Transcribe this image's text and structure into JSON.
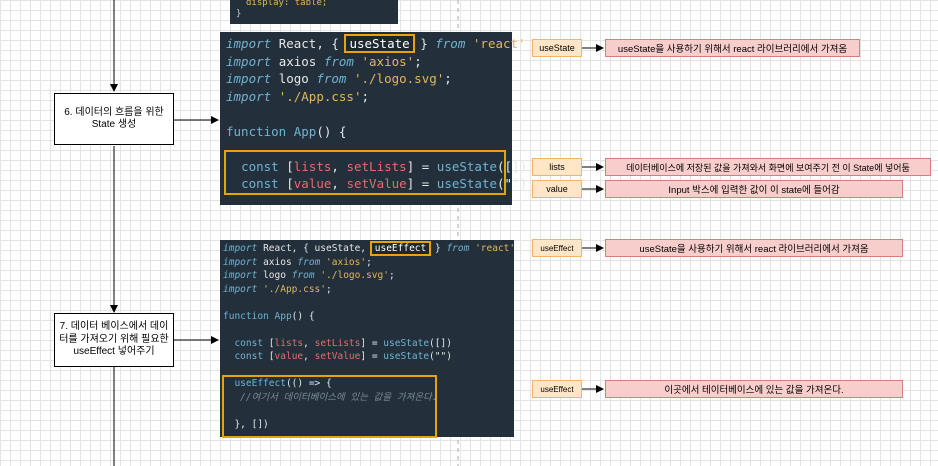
{
  "top_fragment": {
    "line": "display: table;",
    "brace": "}"
  },
  "step6": {
    "label": "6. 데이터의 흐름을 위한 State 생성"
  },
  "step7": {
    "label": "7. 데이터 베이스에서 데이터를 가져오기 위해 필요한 useEffect 넣어주기"
  },
  "code1": {
    "l1_import": "import",
    "l1_react": "React, {",
    "l1_usestate": "useState",
    "l1_close": "}",
    "l1_from": "from",
    "l1_str": "'react'",
    "l2_import": "import",
    "l2_name": "axios",
    "l2_from": "from",
    "l2_str": "'axios'",
    "l2_semi": ";",
    "l3_import": "import",
    "l3_name": "logo",
    "l3_from": "from",
    "l3_str": "'./logo.svg'",
    "l3_semi": ";",
    "l4_import": "import",
    "l4_str": "'./App.css'",
    "l4_semi": ";",
    "l5_function": "function",
    "l5_app": "App",
    "l5_rest": "() {",
    "l6_const": "const",
    "l6_open": "[",
    "l6_lists": "lists",
    "l6_comma": ",",
    "l6_setlists": "setLists",
    "l6_eq": "] =",
    "l6_call": "useState",
    "l6_args": "([])",
    "l7_const": "const",
    "l7_open": "[",
    "l7_value": "value",
    "l7_comma": ",",
    "l7_setvalue": "setValue",
    "l7_eq": "] =",
    "l7_call": "useState",
    "l7_args": "(\"\")"
  },
  "code2": {
    "l1_import": "import",
    "l1_react": "React, { useState,",
    "l1_useeffect": "useEffect",
    "l1_close": "}",
    "l1_from": "from",
    "l1_str": "'react'",
    "l2_import": "import",
    "l2_name": "axios",
    "l2_from": "from",
    "l2_str": "'axios'",
    "l2_semi": ";",
    "l3_import": "import",
    "l3_name": "logo",
    "l3_from": "from",
    "l3_str": "'./logo.svg'",
    "l3_semi": ";",
    "l4_import": "import",
    "l4_str": "'./App.css'",
    "l4_semi": ";",
    "l5_function": "function",
    "l5_app": "App",
    "l5_rest": "() {",
    "l6_const": "const",
    "l6_open": "[",
    "l6_lists": "lists",
    "l6_comma": ",",
    "l6_setlists": "setLists",
    "l6_eq": "] =",
    "l6_call": "useState",
    "l6_args": "([])",
    "l7_const": "const",
    "l7_open": "[",
    "l7_value": "value",
    "l7_comma": ",",
    "l7_setvalue": "setValue",
    "l7_eq": "] =",
    "l7_call": "useState",
    "l7_args": "(\"\")",
    "l8_call": "useEffect",
    "l8_rest": "(() => {",
    "l9_comment": "//여기서 데이터베이스에 있는 값을 가져온다.",
    "l10_close": "}, [])"
  },
  "annotations": [
    {
      "tag": "useState",
      "note": "useState을 사용하기 위해서 react 라이브러리에서 가져옴"
    },
    {
      "tag": "lists",
      "note": "데이터베이스에 저장된 값을 가져와서 화면에 보여주기 전 이 State에 넣어둠"
    },
    {
      "tag": "value",
      "note": "Input 박스에 입력한 값이 이 state에 들어감"
    },
    {
      "tag": "useEffect",
      "note": "useState을 사용하기 위해서 react 라이브러리에서 가져옴"
    },
    {
      "tag": "useEffect",
      "note": "이곳에서 테이터베이스에 있는 값을 가져온다."
    }
  ],
  "colors": {
    "code_bg": "#23303b",
    "highlight": "#e8a20a",
    "tag_fill": "#ffe6c7",
    "note_fill": "#f8cecc"
  }
}
